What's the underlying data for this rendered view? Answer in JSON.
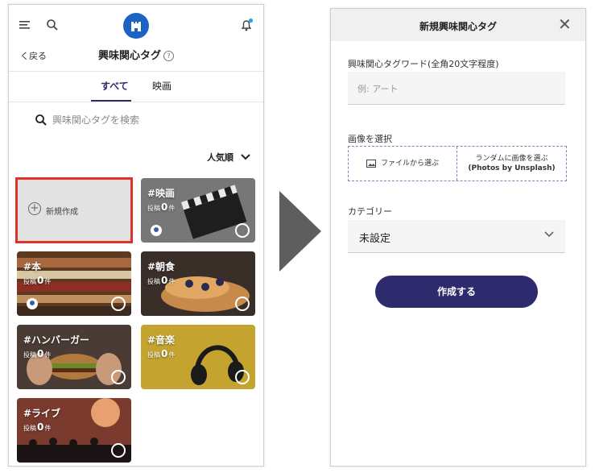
{
  "left": {
    "header": {
      "back_label": "く戻る",
      "title": "興味関心タグ",
      "help_glyph": "?"
    },
    "tabs": [
      {
        "label": "すべて",
        "active": true
      },
      {
        "label": "映画",
        "active": false
      }
    ],
    "search": {
      "placeholder": "興味関心タグを検索"
    },
    "sort": {
      "label": "人気順"
    },
    "new_card": {
      "label": "新規作成"
    },
    "count_prefix": "投稿",
    "count_suffix": "件",
    "cards": [
      {
        "title": "#映画",
        "count": "0",
        "bg": "#6b6b6b"
      },
      {
        "title": "#本",
        "count": "0",
        "bg": "#7a5236"
      },
      {
        "title": "#朝食",
        "count": "0",
        "bg": "#4a3a30"
      },
      {
        "title": "#ハンバーガー",
        "count": "0",
        "bg": "#5a4a3e"
      },
      {
        "title": "#音楽",
        "count": "0",
        "bg": "#b89a2a"
      },
      {
        "title": "#ライブ",
        "count": "0",
        "bg": "#8a4a3a"
      }
    ]
  },
  "right": {
    "header": {
      "title": "新規興味関心タグ",
      "close_glyph": "✕"
    },
    "tag_word": {
      "label": "興味関心タグワード(全角20文字程度)",
      "placeholder": "例: アート"
    },
    "image": {
      "label": "画像を選択",
      "file_button": "ファイルから選ぶ",
      "random_button_line1": "ランダムに画像を選ぶ",
      "random_button_line2": "(Photos by Unsplash)"
    },
    "category": {
      "label": "カテゴリー",
      "value": "未設定"
    },
    "submit_label": "作成する"
  },
  "colors": {
    "accent": "#2d2a6e",
    "logo": "#1c63c4",
    "highlight": "#e0312a",
    "notify_dot": "#2aa7e0"
  }
}
